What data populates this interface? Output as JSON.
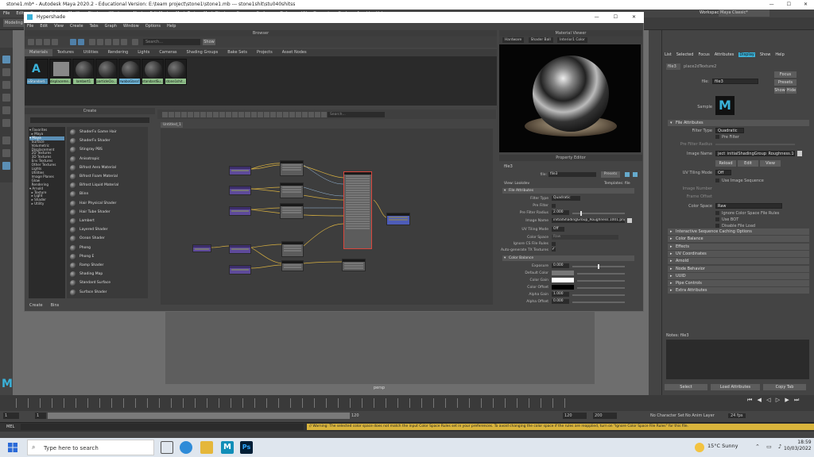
{
  "maya": {
    "title": "stone1.mb* - Autodesk Maya 2020.2 - Educational Version: E:\\team project\\stone1\\stone1.mb   ---   stone1shit\\stu040shitss",
    "menu": [
      "File",
      "Edit",
      "Create",
      "Select",
      "Modify",
      "Display",
      "Windows",
      "Mesh",
      "Edit Mesh",
      "Mesh Tools",
      "Mesh Display",
      "Curves",
      "Surfaces",
      "Deform",
      "UV",
      "Generate",
      "Cache",
      "Arnold",
      "Help"
    ],
    "mode": "Modeling",
    "workspace_label": "Workspace :",
    "workspace_value": "Maya Classic*",
    "viewport_label": "persp"
  },
  "hypershade": {
    "title": "Hypershade",
    "menu": [
      "File",
      "Edit",
      "View",
      "Create",
      "Tabs",
      "Graph",
      "Window",
      "Options",
      "Help"
    ],
    "browser_label": "Browser",
    "search_placeholder": "Search...",
    "show_label": "Show",
    "tabs": [
      "Materials",
      "Textures",
      "Utilities",
      "Rendering",
      "Lights",
      "Cameras",
      "Shading Groups",
      "Bake Sets",
      "Projects",
      "Asset Nodes"
    ],
    "swatches": [
      "aiStandard...",
      "displaceme...",
      "lambert1",
      "particleClo...",
      "rwaboGlass!",
      "standardSu...",
      "stone1shit..."
    ],
    "create_label": "Create",
    "create_tree": [
      "▾ Favorites",
      "  ▸ Maya",
      "▾ Maya",
      "  Surface",
      "  Volumetric",
      "  Displacement",
      "  2D Textures",
      "  3D Textures",
      "  Env Textures",
      "  Other Textures",
      "  Lights",
      "  Utilities",
      "  Image Planes",
      "  Glow",
      "  Rendering",
      "▾ Arnold",
      "  ▸ Texture",
      "  ▸ Light",
      "  ▸ Shader",
      "  ▸ Utility"
    ],
    "create_items": [
      "ShaderFx Game Hair",
      "ShaderFx Shader",
      "Stingray PBS",
      "Anisotropic",
      "Bifrost Aero Material",
      "Bifrost Foam Material",
      "Bifrost Liquid Material",
      "Blinn",
      "Hair Physical Shader",
      "Hair Tube Shader",
      "Lambert",
      "Layered Shader",
      "Ocean Shader",
      "Phong",
      "Phong E",
      "Ramp Shader",
      "Shading Map",
      "Standard Surface",
      "Surface Shader"
    ],
    "create_tabs": [
      "Create",
      "Bins"
    ],
    "graph_search_placeholder": "Search...",
    "graph_tab": "Untitled_1"
  },
  "material_viewer": {
    "label": "Material Viewer",
    "renderer": "Hardware",
    "geometry": "Shader Ball",
    "env": "Interior1 Color"
  },
  "property_editor": {
    "label": "Property Editor",
    "node": "file3",
    "file_label": "file:",
    "file_value": "file3",
    "presets": "Presets",
    "view_label": "View: Lookdev",
    "templates_label": "Templates: file",
    "section_file": "File Attributes",
    "filter_type_label": "Filter Type",
    "filter_type": "Quadratic",
    "pre_filter_label": "Pre Filter",
    "pre_filter_radius_label": "Pre Filter Radius",
    "pre_filter_radius": "2.000",
    "image_name_label": "Image Name",
    "image_name": "initialShadingGroup_Roughness.1001.png",
    "uv_tiling_label": "UV Tiling Mode",
    "uv_tiling": "Off",
    "color_space_label": "Color Space",
    "color_space": "Raw",
    "ignore_cs_label": "Ignore CS File Rules",
    "auto_tx_label": "Auto-generate TX Textures",
    "section_color": "Color Balance",
    "exposure_label": "Exposure",
    "exposure": "0.000",
    "default_color_label": "Default Color",
    "color_gain_label": "Color Gain",
    "color_offset_label": "Color Offset",
    "alpha_gain_label": "Alpha Gain",
    "alpha_gain": "1.000",
    "alpha_offset_label": "Alpha Offset",
    "alpha_offset": "0.000"
  },
  "attribute_editor": {
    "tabs": [
      "List",
      "Selected",
      "Focus",
      "Attributes",
      "Display",
      "Show",
      "Help"
    ],
    "node_tab": "file3",
    "node_tab2": "place2dTexture2",
    "file_label": "file:",
    "file_value": "file3",
    "focus": "Focus",
    "presets": "Presets",
    "show": "Show",
    "hide": "Hide",
    "sample_label": "Sample",
    "section_file": "File Attributes",
    "filter_type_label": "Filter Type",
    "filter_type": "Quadratic",
    "pre_filter_label": "Pre Filter",
    "pre_filter_radius_label": "Pre Filter Radius",
    "image_name_label": "Image Name",
    "image_name": "ject_initialShadingGroup_Roughness.1001.png",
    "reload": "Reload",
    "edit": "Edit",
    "view": "View",
    "uv_tiling_label": "UV Tiling Mode",
    "uv_tiling": "Off",
    "use_image_seq": "Use Image Sequence",
    "image_number_label": "Image Number",
    "frame_offset_label": "Frame Offset",
    "color_space_label": "Color Space",
    "color_space": "Raw",
    "ignore_cs": "Ignore Color Space File Rules",
    "use_bot": "Use BOT",
    "disable_file_load": "Disable File Load",
    "sections": [
      "Interactive Sequence Caching Options",
      "Color Balance",
      "Effects",
      "UV Coordinates",
      "Arnold",
      "Node Behavior",
      "UUID",
      "Extra Attributes",
      "Hardware Texturing"
    ],
    "sections_real": [
      "Interactive Sequence Caching Options",
      "Color Balance",
      "Effects",
      "UV Coordinates",
      "Arnold",
      "Node Behavior",
      "UUID",
      "Pipe Controls",
      "Extra Attributes"
    ],
    "notes_label": "Notes: file3",
    "select": "Select",
    "load_attrs": "Load Attributes",
    "copy_tab": "Copy Tab"
  },
  "timeline": {
    "start": "1",
    "current": "1",
    "range_end": "120",
    "end": "120",
    "max": "200",
    "char_set": "No Character Set",
    "anim_layer": "No Anim Layer",
    "fps": "24 fps",
    "mel_label": "MEL",
    "warning": "// Warning: The selected color space does not match the input Color Space Rules set in your preferences. To avoid changing the color space if the rules are reapplied, turn on \"Ignore Color Space File Rules\" for this file."
  },
  "taskbar": {
    "search_placeholder": "Type here to search",
    "weather": "15°C  Sunny",
    "time": "18:59",
    "date": "10/03/2022"
  },
  "colors": {
    "maya_blue": "#3ab1d8",
    "selection_red": "#d9463c",
    "warning_yellow": "#d9b43c"
  }
}
